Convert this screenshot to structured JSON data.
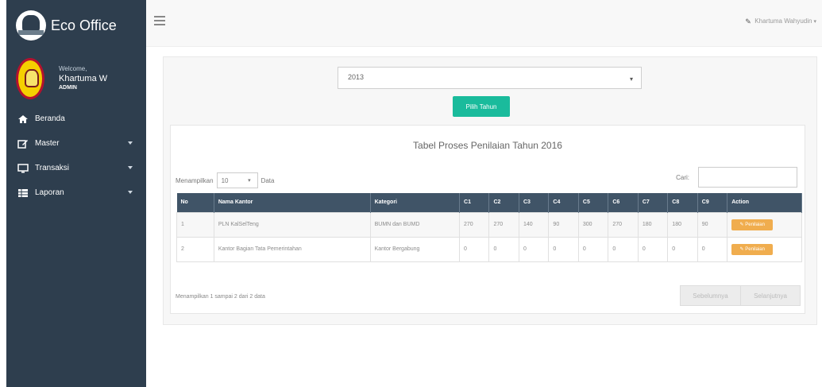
{
  "brand": {
    "title": "Eco Office"
  },
  "user": {
    "welcome": "Welcome,",
    "name": "Khartuma W",
    "role": "ADMIN"
  },
  "menu": [
    {
      "label": "Beranda",
      "has_caret": false
    },
    {
      "label": "Master",
      "has_caret": true
    },
    {
      "label": "Transaksi",
      "has_caret": true
    },
    {
      "label": "Laporan",
      "has_caret": true
    }
  ],
  "topbar": {
    "user_link": "Khartuma Wahyudin"
  },
  "filter": {
    "year_value": "2013",
    "pick_button": "Pilih Tahun"
  },
  "panel": {
    "title": "Tabel Proses Penilaian Tahun 2016",
    "length_label_before": "Menampilkan",
    "length_value": "10",
    "length_label_after": "Data",
    "search_label": "Cari:",
    "info": "Menampilkan 1 sampai 2 dari 2 data"
  },
  "table": {
    "headers": [
      "No",
      "Nama Kantor",
      "Kategori",
      "C1",
      "C2",
      "C3",
      "C4",
      "C5",
      "C6",
      "C7",
      "C8",
      "C9",
      "Action"
    ],
    "rows": [
      [
        "1",
        "PLN KalSelTeng",
        "BUMN dan BUMD",
        "270",
        "270",
        "140",
        "90",
        "300",
        "270",
        "180",
        "180",
        "90"
      ],
      [
        "2",
        "Kantor Bagian Tata Pemerintahan",
        "Kantor Bergabung",
        "0",
        "0",
        "0",
        "0",
        "0",
        "0",
        "0",
        "0",
        "0"
      ]
    ],
    "action_label": "Penilaian"
  },
  "pager": {
    "prev": "Sebelumnya",
    "next": "Selanjutnya"
  },
  "colors": {
    "sidebar": "#2e3e4e",
    "table_header": "#405467",
    "button_green": "#1abb9c",
    "button_orange": "#f0ad4e"
  }
}
